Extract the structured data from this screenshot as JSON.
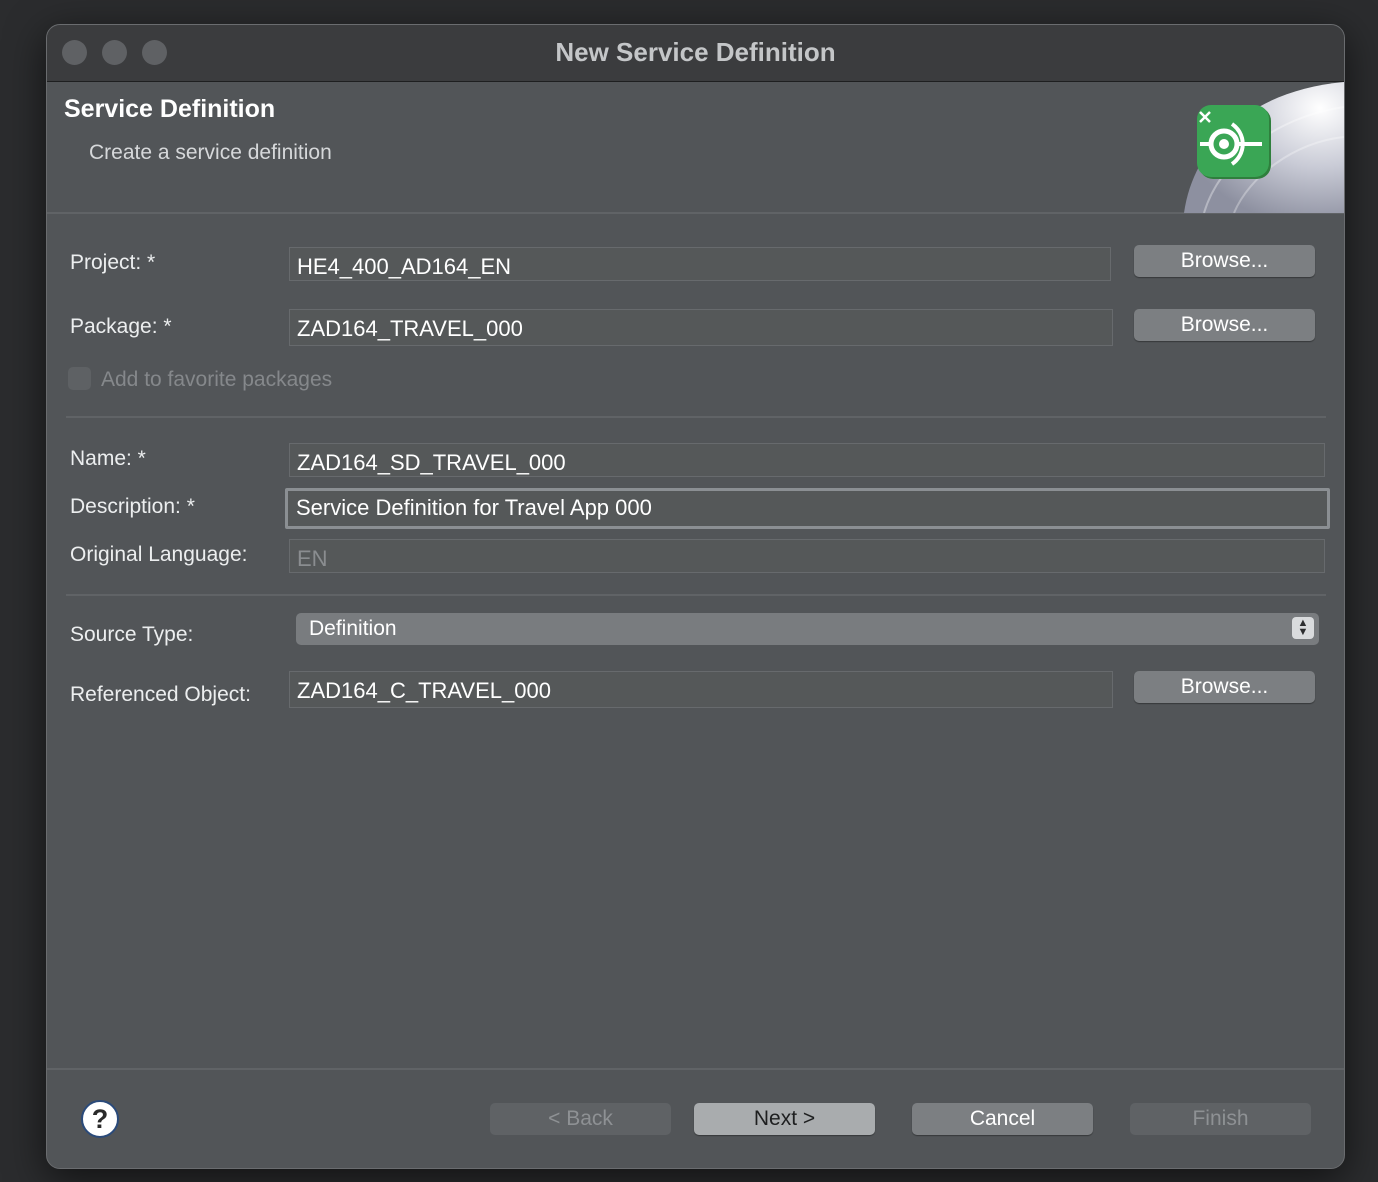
{
  "window": {
    "title": "New Service Definition"
  },
  "header": {
    "title": "Service Definition",
    "subtitle": "Create a service definition"
  },
  "form": {
    "project": {
      "label": "Project: *",
      "value": "HE4_400_AD164_EN",
      "browse_label": "Browse..."
    },
    "package": {
      "label": "Package: *",
      "value": "ZAD164_TRAVEL_000",
      "browse_label": "Browse..."
    },
    "favorite": {
      "label": "Add to favorite packages",
      "checked": false
    },
    "name": {
      "label": "Name: *",
      "value": "ZAD164_SD_TRAVEL_000"
    },
    "description": {
      "label": "Description: *",
      "value": "Service Definition for Travel App 000"
    },
    "original_language": {
      "label": "Original Language:",
      "value": "EN"
    },
    "source_type": {
      "label": "Source Type:",
      "value": "Definition"
    },
    "referenced_object": {
      "label": "Referenced Object:",
      "value": "ZAD164_C_TRAVEL_000",
      "browse_label": "Browse..."
    }
  },
  "footer": {
    "help": "?",
    "back": "< Back",
    "next": "Next >",
    "cancel": "Cancel",
    "finish": "Finish"
  },
  "colors": {
    "background": "#525558",
    "titlebar": "#3b3c3e",
    "primary_button": "#a9acae",
    "icon_green": "#3aa655"
  }
}
